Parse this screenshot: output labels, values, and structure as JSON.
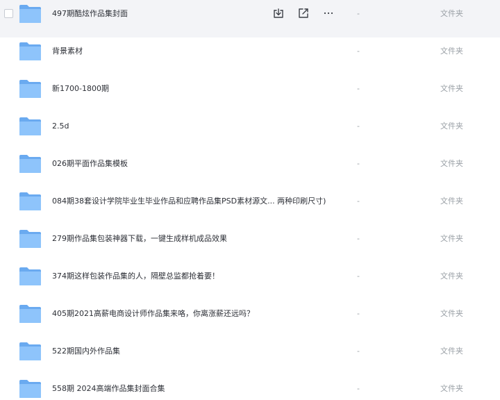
{
  "colors": {
    "folder_back": "#6aaaf0",
    "folder_front": "#8ec4fb",
    "hover_bg": "#f3f4f7",
    "muted_text": "#9aa0a6"
  },
  "row_actions": {
    "download_icon": "download-icon",
    "share_icon": "share-icon",
    "more_icon": "more-icon",
    "more_label": "···"
  },
  "files": [
    {
      "name": "497期酷炫作品集封面",
      "size": "-",
      "type": "文件夹",
      "icon": "folder-icon",
      "hovered": true
    },
    {
      "name": "背景素材",
      "size": "-",
      "type": "文件夹",
      "icon": "folder-icon"
    },
    {
      "name": "新1700-1800期",
      "size": "-",
      "type": "文件夹",
      "icon": "folder-icon"
    },
    {
      "name": "2.5d",
      "size": "-",
      "type": "文件夹",
      "icon": "folder-icon"
    },
    {
      "name": "026期平面作品集模板",
      "size": "-",
      "type": "文件夹",
      "icon": "folder-icon"
    },
    {
      "name": "084期38套设计学院毕业生毕业作品和应聘作品集PSD素材源文... 两种印刷尺寸)",
      "size": "-",
      "type": "文件夹",
      "icon": "folder-icon"
    },
    {
      "name": "279期作品集包装神器下载，一键生成样机成品效果",
      "size": "-",
      "type": "文件夹",
      "icon": "folder-icon"
    },
    {
      "name": "374期这样包装作品集的人，隔壁总监都抢着要！",
      "size": "-",
      "type": "文件夹",
      "icon": "folder-icon"
    },
    {
      "name": "405期2021高薪电商设计师作品集来咯，你离涨薪还远吗？",
      "size": "-",
      "type": "文件夹",
      "icon": "folder-icon"
    },
    {
      "name": "522期国内外作品集",
      "size": "-",
      "type": "文件夹",
      "icon": "folder-icon"
    },
    {
      "name": "558期 2024高端作品集封面合集",
      "size": "-",
      "type": "文件夹",
      "icon": "folder-icon"
    }
  ]
}
